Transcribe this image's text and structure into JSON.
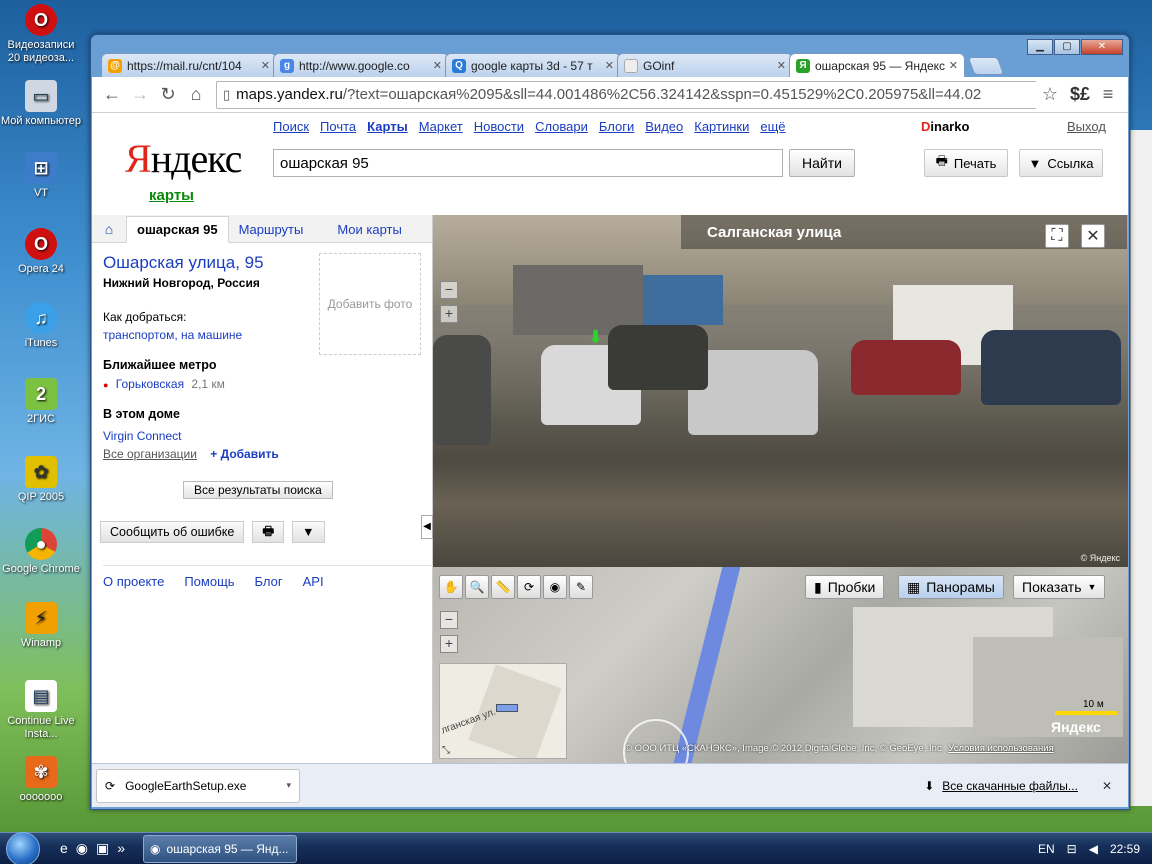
{
  "desktop": {
    "icons": [
      {
        "label": "Видеозаписи 20 видеоза...",
        "icon": "opera-icon"
      },
      {
        "label": "Мой компьютер",
        "icon": "computer-icon"
      },
      {
        "label": "VT",
        "icon": "network-icon"
      },
      {
        "label": "Opera 24",
        "icon": "opera-icon"
      },
      {
        "label": "iTunes",
        "icon": "itunes-icon"
      },
      {
        "label": "2ГИС",
        "icon": "2gis-icon"
      },
      {
        "label": "QIP 2005",
        "icon": "qip-icon"
      },
      {
        "label": "Google Chrome",
        "icon": "chrome-icon"
      },
      {
        "label": "Winamp",
        "icon": "winamp-icon"
      },
      {
        "label": "Continue Live Insta...",
        "icon": "installer-icon"
      },
      {
        "label": "ooooooo",
        "icon": "image-icon"
      }
    ]
  },
  "browser": {
    "tabs": [
      {
        "title": "https://mail.ru/cnt/104",
        "fav": "mail-icon",
        "color": "#f5a000"
      },
      {
        "title": "http://www.google.co",
        "fav": "google-icon",
        "color": "#4a86e8"
      },
      {
        "title": "google карты 3d - 57 т",
        "fav": "search-icon",
        "color": "#2a7ad8"
      },
      {
        "title": "GOinf",
        "fav": "page-icon",
        "color": "#dddddd"
      },
      {
        "title": "ошарская 95 — Яндекс",
        "fav": "yandex-icon",
        "color": "#2aa22a"
      }
    ],
    "url_host": "maps.yandex.ru",
    "url_rest": "/?text=ошарская%2095&sll=44.001486%2C56.324142&sspn=0.451529%2C0.205975&ll=44.02"
  },
  "yandex": {
    "logo_first": "Я",
    "logo_rest": "ндекс",
    "logo_sub": "карты",
    "services": [
      "Поиск",
      "Почта",
      "Карты",
      "Маркет",
      "Новости",
      "Словари",
      "Блоги",
      "Видео",
      "Картинки",
      "ещё"
    ],
    "user_first": "D",
    "user_rest": "inarko",
    "logout": "Выход",
    "search_value": "ошарская 95",
    "search_button": "Найти",
    "print": "Печать",
    "link": "Ссылка"
  },
  "left": {
    "tab_active": "ошарская 95",
    "tab_routes": "Маршруты",
    "tab_mymaps": "Мои карты",
    "address": "Ошарская улица, 95",
    "city": "Нижний Новгород, Россия",
    "add_photo": "Добавить фото",
    "how_to": "Как добраться:",
    "transport": "транспортом, на машине",
    "metro_header": "Ближайшее метро",
    "metro_name": "Горьковская",
    "metro_dist": "2,1 км",
    "house_header": "В этом доме",
    "org": "Virgin Connect",
    "all_orgs": "Все организации",
    "add": "+ Добавить",
    "all_results": "Все результаты поиска",
    "report_error": "Сообщить об ошибке",
    "footer": [
      "О проекте",
      "Помощь",
      "Блог",
      "API"
    ]
  },
  "pano": {
    "street": "Салганская улица",
    "copyright": "© Яндекс"
  },
  "map": {
    "traffic": "Пробки",
    "panoramas": "Панорамы",
    "show": "Показать",
    "scale": "10 м",
    "brand": "Яндекс",
    "copyright": "© ООО ИТЦ «СКАНЭКС», Image © 2012 DigitalGlobe, Inc, © GeoEye, Inc",
    "terms": "Условия использования",
    "mini_street": "лганская ул."
  },
  "downloads": {
    "file": "GoogleEarthSetup.exe",
    "all": "Все скачанные файлы..."
  },
  "taskbar": {
    "task_title": "ошарская 95 — Янд...",
    "lang": "EN",
    "time": "22:59"
  }
}
